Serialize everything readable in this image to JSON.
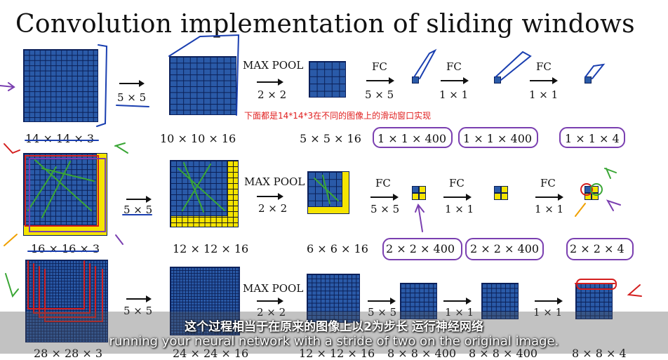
{
  "slide": {
    "title": "Convolution implementation of sliding windows",
    "note_cn": "下面都是14*14*3在不同的图像上的滑动窗口实现",
    "op_labels": {
      "conv": "5 × 5",
      "maxpool": "MAX POOL",
      "pool_size": "2 × 2",
      "fc": "FC",
      "one": "1 × 1"
    },
    "row1": {
      "dims": [
        "14 × 14 × 3",
        "10 × 10 × 16",
        "5 × 5 × 16",
        "1 × 1 × 400",
        "1 × 1 × 400",
        "1 × 1 × 4"
      ]
    },
    "row2": {
      "dims": [
        "16 × 16 × 3",
        "12 × 12 × 16",
        "6 × 6 × 16",
        "2 × 2 × 400",
        "2 × 2 × 400",
        "2 × 2 × 4"
      ]
    },
    "row3": {
      "dims": [
        "28 × 28 × 3",
        "24 × 24 × 16",
        "12 × 12 × 16",
        "8 × 8 × 400",
        "8 × 8 × 400",
        "8 × 8 × 4"
      ]
    }
  },
  "subtitles": {
    "cn": "这个过程相当于在原来的图像上以2为步长  运行神经网络",
    "en": "running your neural network with a stride of two on the original image."
  },
  "colors": {
    "grid_blue": "#2a5aa8",
    "grid_line": "#0b1f55",
    "yellow": "#f5e400",
    "ink_blue": "#1a3fb0",
    "ink_green": "#3aa635",
    "ink_purple": "#7a3fb0",
    "ink_red": "#d41f1f",
    "ink_orange": "#f0a000"
  }
}
